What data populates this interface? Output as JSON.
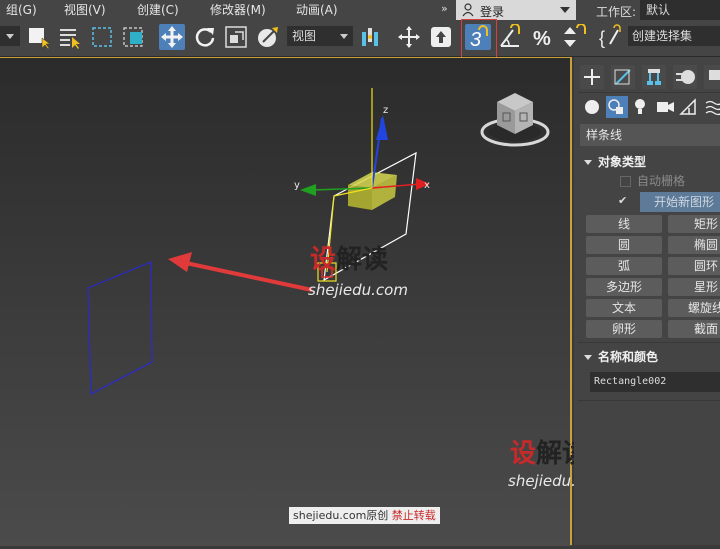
{
  "menu": {
    "items": [
      "组(G)",
      "视图(V)",
      "创建(C)",
      "修改器(M)",
      "动画(A)"
    ],
    "overflow": "»"
  },
  "login": {
    "label": "登录"
  },
  "workspace": {
    "label": "工作区:",
    "value": "默认"
  },
  "toolbar": {
    "view_dropdown": "视图",
    "selection_set": "创建选择集",
    "snap_number": "3"
  },
  "viewport": {
    "axes": {
      "x": "x",
      "y": "y",
      "z": "z"
    },
    "colors": {
      "x_axis": "#e02020",
      "y_axis": "#20b020",
      "z_axis": "#2040e0",
      "selected": "#f0f020",
      "accent_border": "#c8a23a"
    }
  },
  "command_panel": {
    "category": "样条线",
    "object_type": {
      "title": "对象类型",
      "auto_grid": "自动栅格",
      "start_new_shape_check": "✔",
      "start_new_shape": "开始新图形",
      "buttons": [
        "线",
        "矩形",
        "圆",
        "椭圆",
        "弧",
        "圆环",
        "多边形",
        "星形",
        "文本",
        "螺旋线",
        "卵形",
        "截面"
      ]
    },
    "name_color": {
      "title": "名称和颜色",
      "name_value": "Rectangle002"
    }
  },
  "watermark": {
    "logo_a": "设",
    "logo_b": "解读",
    "url": "shejiedu.com",
    "copyright_prefix": "shejiedu.com原创",
    "copyright_red": "禁止转载"
  }
}
